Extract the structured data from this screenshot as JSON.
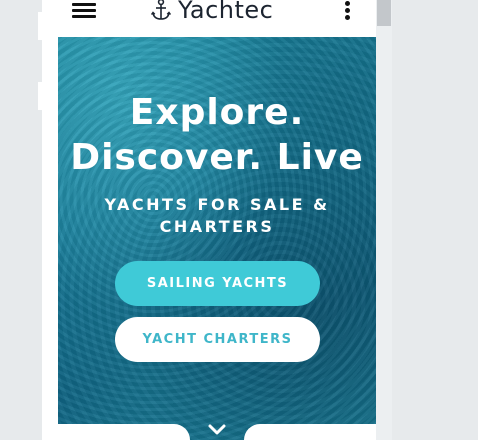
{
  "navbar": {
    "brand_name": "Yachtec",
    "brand_icon": "anchor-icon",
    "menu_icon": "hamburger-menu-icon",
    "more_icon": "more-vertical-icon"
  },
  "hero": {
    "headline_line1": "Explore.",
    "headline_line2": "Discover. Live",
    "subheadline_line1": "YACHTS FOR SALE &",
    "subheadline_line2": "CHARTERS",
    "primary_button_label": "SAILING YACHTS",
    "secondary_button_label": "YACHT CHARTERS",
    "scroll_icon": "chevron-down-icon"
  },
  "colors": {
    "accent": "#3fcad7",
    "secondary_text": "#3fb6c9",
    "brand_text": "#1c2430",
    "hero_base": "#167896"
  }
}
